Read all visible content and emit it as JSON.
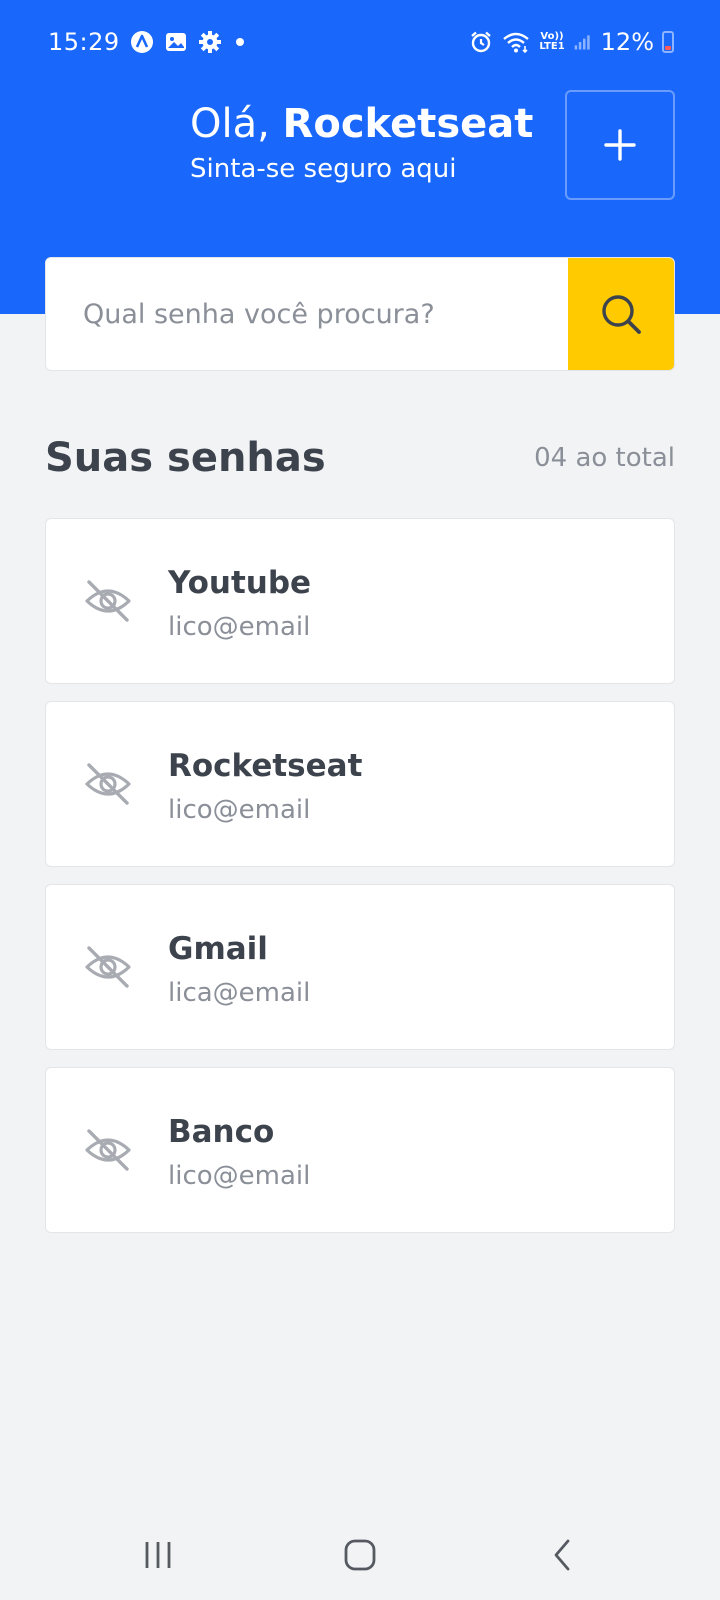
{
  "status_bar": {
    "time": "15:29",
    "volte_top": "Vo))",
    "volte_bottom": "LTE1",
    "battery": "12%",
    "icons": [
      "a-logo-icon",
      "gallery-icon",
      "gear-icon",
      "dot-icon",
      "alarm-icon",
      "wifi-icon",
      "volte-icon",
      "signal-icon",
      "battery-icon"
    ]
  },
  "header": {
    "greeting_prefix": "Olá, ",
    "user_name": "Rocketseat",
    "subtitle": "Sinta-se seguro aqui",
    "add_icon": "plus-icon"
  },
  "search": {
    "placeholder": "Qual senha você procura?",
    "value": "",
    "icon": "search-icon"
  },
  "section": {
    "title": "Suas senhas",
    "count": "04 ao total"
  },
  "passwords": [
    {
      "title": "Youtube",
      "email": "lico@email",
      "icon": "eye-off-icon"
    },
    {
      "title": "Rocketseat",
      "email": "lico@email",
      "icon": "eye-off-icon"
    },
    {
      "title": "Gmail",
      "email": "lica@email",
      "icon": "eye-off-icon"
    },
    {
      "title": "Banco",
      "email": "lico@email",
      "icon": "eye-off-icon"
    }
  ],
  "nav": {
    "icons": [
      "recent-apps-icon",
      "home-icon",
      "back-icon"
    ]
  },
  "colors": {
    "primary": "#1967FB",
    "accent": "#FFCA00",
    "background": "#F2F3F5",
    "card": "#FFFFFF",
    "text": "#3D434D",
    "muted": "#8A8F98"
  }
}
